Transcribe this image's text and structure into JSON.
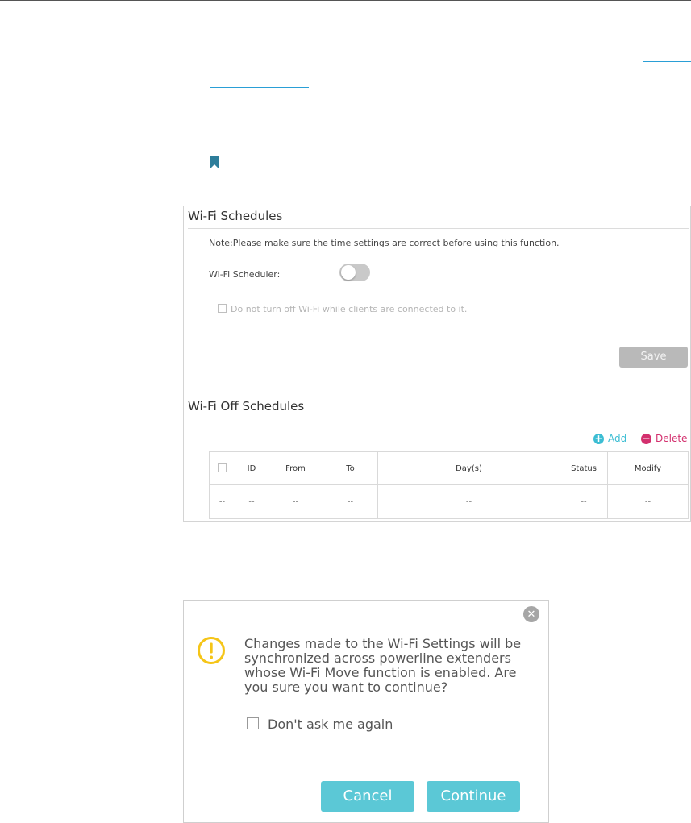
{
  "colors": {
    "accent": "#5bc8d6",
    "add": "#3cbdd3",
    "delete": "#d3306e",
    "warning": "#f5c518",
    "link": "#2a9fd6",
    "bookmark": "#2e7d9a"
  },
  "schedules": {
    "title": "Wi-Fi Schedules",
    "note": "Note:Please make sure the time settings are correct before using this function.",
    "scheduler_label": "Wi-Fi Scheduler:",
    "scheduler_enabled": false,
    "keep_on_label": "Do not turn off Wi-Fi while clients are connected to it.",
    "save_label": "Save"
  },
  "off_schedules": {
    "title": "Wi-Fi Off Schedules",
    "add_label": "Add",
    "delete_label": "Delete",
    "add_icon": "plus-circle-icon",
    "delete_icon": "minus-circle-icon",
    "columns": [
      "ID",
      "From",
      "To",
      "Day(s)",
      "Status",
      "Modify"
    ],
    "rows": [
      [
        "--",
        "--",
        "--",
        "--",
        "--",
        "--",
        "--"
      ]
    ]
  },
  "dialog": {
    "close_icon": "close-icon",
    "warning_icon": "exclamation-circle-icon",
    "message": "Changes made to the Wi-Fi Settings will be synchronized across powerline extenders whose Wi-Fi Move function is enabled. Are you sure you want to continue?",
    "dont_ask_label": "Don't ask me again",
    "cancel_label": "Cancel",
    "continue_label": "Continue"
  }
}
